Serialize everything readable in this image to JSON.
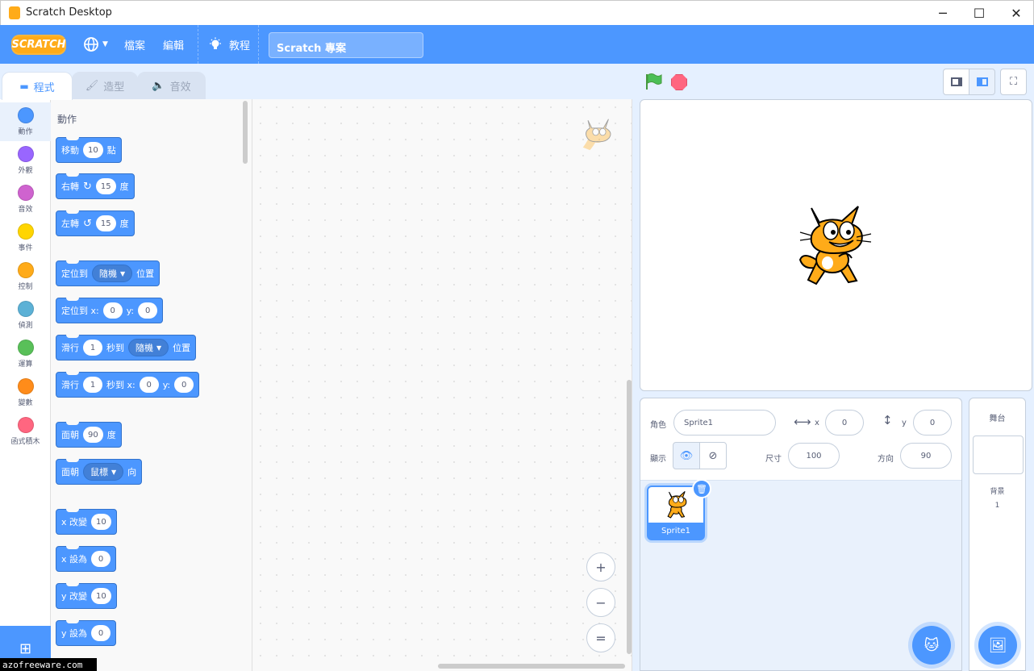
{
  "window": {
    "title": "Scratch Desktop",
    "minimize": "─",
    "maximize": "☐",
    "close": "✕"
  },
  "menubar": {
    "logo": "SCRATCH",
    "language_icon": "globe-icon",
    "file": "檔案",
    "edit": "編輯",
    "tutorials": "教程",
    "project_title": "Scratch 專案"
  },
  "tabs": [
    {
      "label": "程式",
      "icon": "code-icon"
    },
    {
      "label": "造型",
      "icon": "brush-icon"
    },
    {
      "label": "音效",
      "icon": "speaker-icon"
    }
  ],
  "categories": [
    {
      "label": "動作",
      "color": "#4c97ff"
    },
    {
      "label": "外觀",
      "color": "#9966ff"
    },
    {
      "label": "音效",
      "color": "#cf63cf"
    },
    {
      "label": "事件",
      "color": "#ffd500"
    },
    {
      "label": "控制",
      "color": "#ffab19"
    },
    {
      "label": "偵測",
      "color": "#5cb1d6"
    },
    {
      "label": "運算",
      "color": "#59c059"
    },
    {
      "label": "變數",
      "color": "#ff8c1a"
    },
    {
      "label": "函式積木",
      "color": "#ff6680"
    }
  ],
  "palette": {
    "heading": "動作",
    "blocks": {
      "move": {
        "a": "移動",
        "v": "10",
        "b": "點"
      },
      "turn_right": {
        "a": "右轉",
        "v": "15",
        "b": "度"
      },
      "turn_left": {
        "a": "左轉",
        "v": "15",
        "b": "度"
      },
      "goto": {
        "a": "定位到",
        "dd": "隨機",
        "b": "位置"
      },
      "goto_xy": {
        "a": "定位到 x:",
        "x": "0",
        "ylbl": "y:",
        "y": "0"
      },
      "glide": {
        "a": "滑行",
        "v": "1",
        "b": "秒到",
        "dd": "隨機",
        "c": "位置"
      },
      "glide_xy": {
        "a": "滑行",
        "v": "1",
        "b": "秒到 x:",
        "x": "0",
        "ylbl": "y:",
        "y": "0"
      },
      "point_dir": {
        "a": "面朝",
        "v": "90",
        "b": "度"
      },
      "point_towards": {
        "a": "面朝",
        "dd": "鼠標",
        "b": "向"
      },
      "change_x": {
        "a": "x 改變",
        "v": "10"
      },
      "set_x": {
        "a": "x 設為",
        "v": "0"
      },
      "change_y": {
        "a": "y 改變",
        "v": "10"
      },
      "set_y": {
        "a": "y 設為",
        "v": "0"
      }
    }
  },
  "workspace": {
    "zoom_in": "+",
    "zoom_out": "−",
    "zoom_reset": "="
  },
  "sprite_info": {
    "sprite_label": "角色",
    "sprite_name": "Sprite1",
    "x_label": "x",
    "x_value": "0",
    "y_label": "y",
    "y_value": "0",
    "show_label": "顯示",
    "size_label": "尺寸",
    "size_value": "100",
    "direction_label": "方向",
    "direction_value": "90"
  },
  "sprite_list": [
    {
      "name": "Sprite1"
    }
  ],
  "stage_panel": {
    "title": "舞台",
    "backdrops_label": "背景",
    "backdrops_count": "1"
  },
  "watermark": "azofreeware.com"
}
